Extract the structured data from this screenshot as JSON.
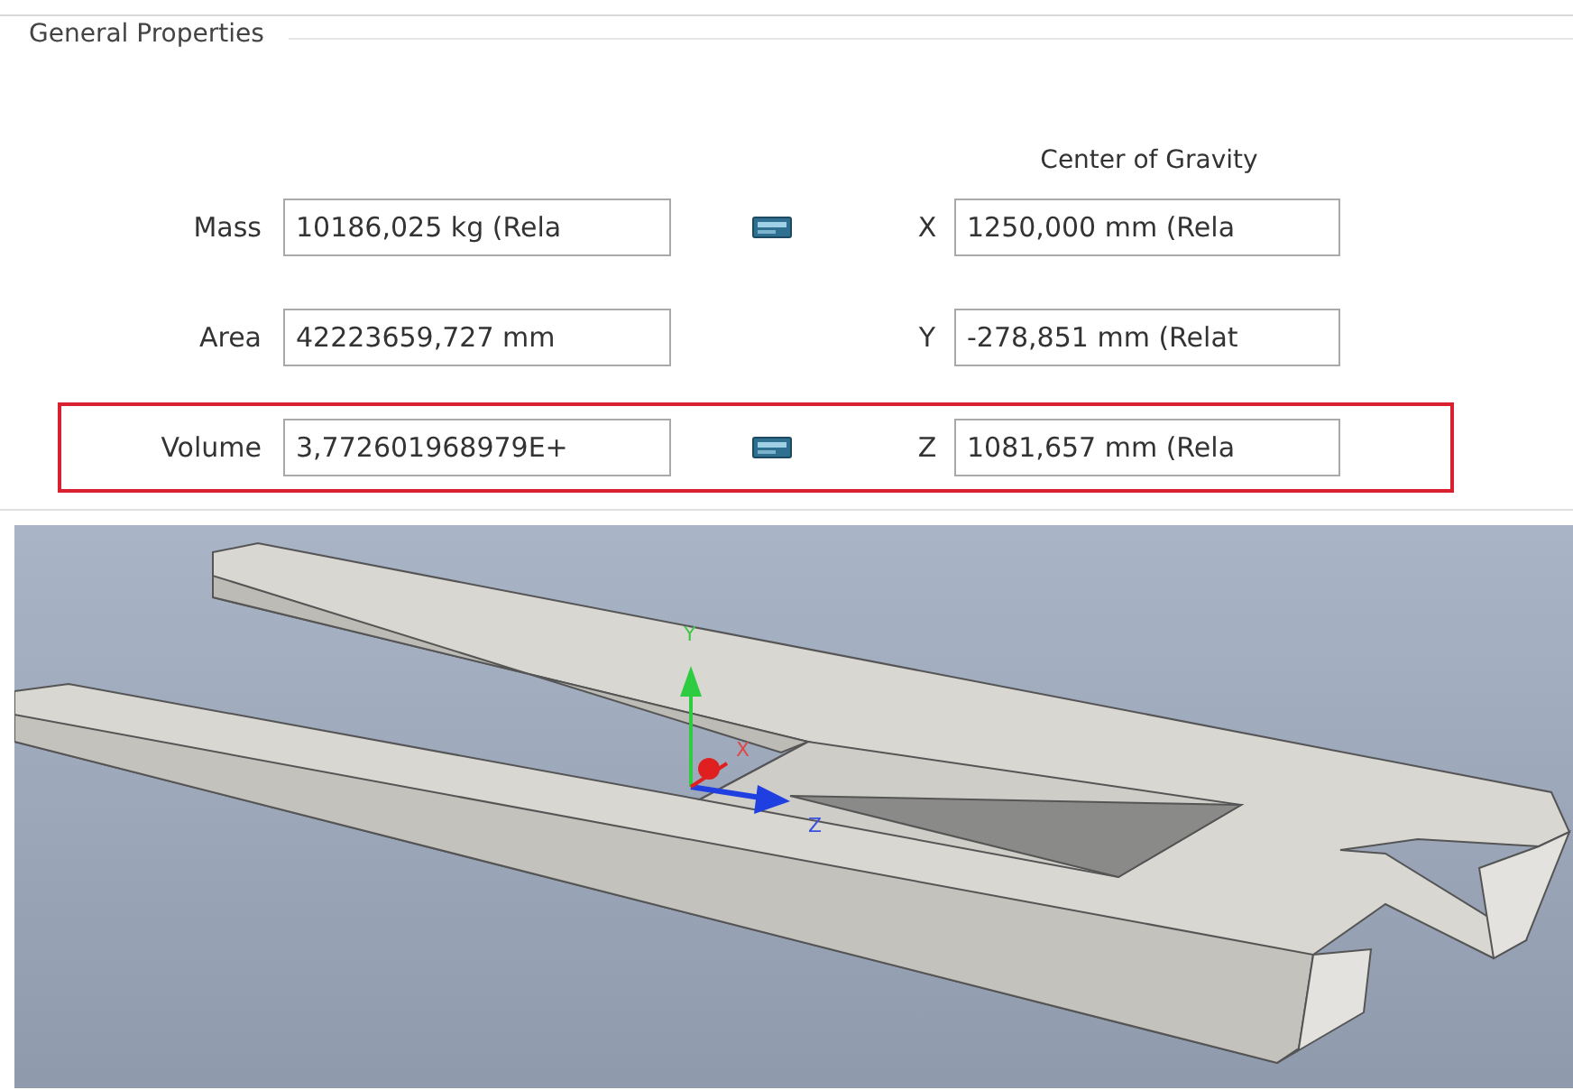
{
  "panel": {
    "title": "General Properties"
  },
  "cog_header": "Center of Gravity",
  "properties": [
    {
      "label": "Mass",
      "value": "10186,025 kg (Rela",
      "calculator": true,
      "axis": "X",
      "cog": "1250,000 mm (Rela",
      "highlighted": false
    },
    {
      "label": "Area",
      "value": "42223659,727 mm",
      "calculator": false,
      "axis": "Y",
      "cog": "-278,851 mm (Relat",
      "highlighted": false
    },
    {
      "label": "Volume",
      "value": "3,772601968979E+",
      "calculator": true,
      "axis": "Z",
      "cog": "1081,657 mm (Rela",
      "highlighted": true
    }
  ],
  "viewport": {
    "triad": [
      "X",
      "Y",
      "Z"
    ]
  }
}
